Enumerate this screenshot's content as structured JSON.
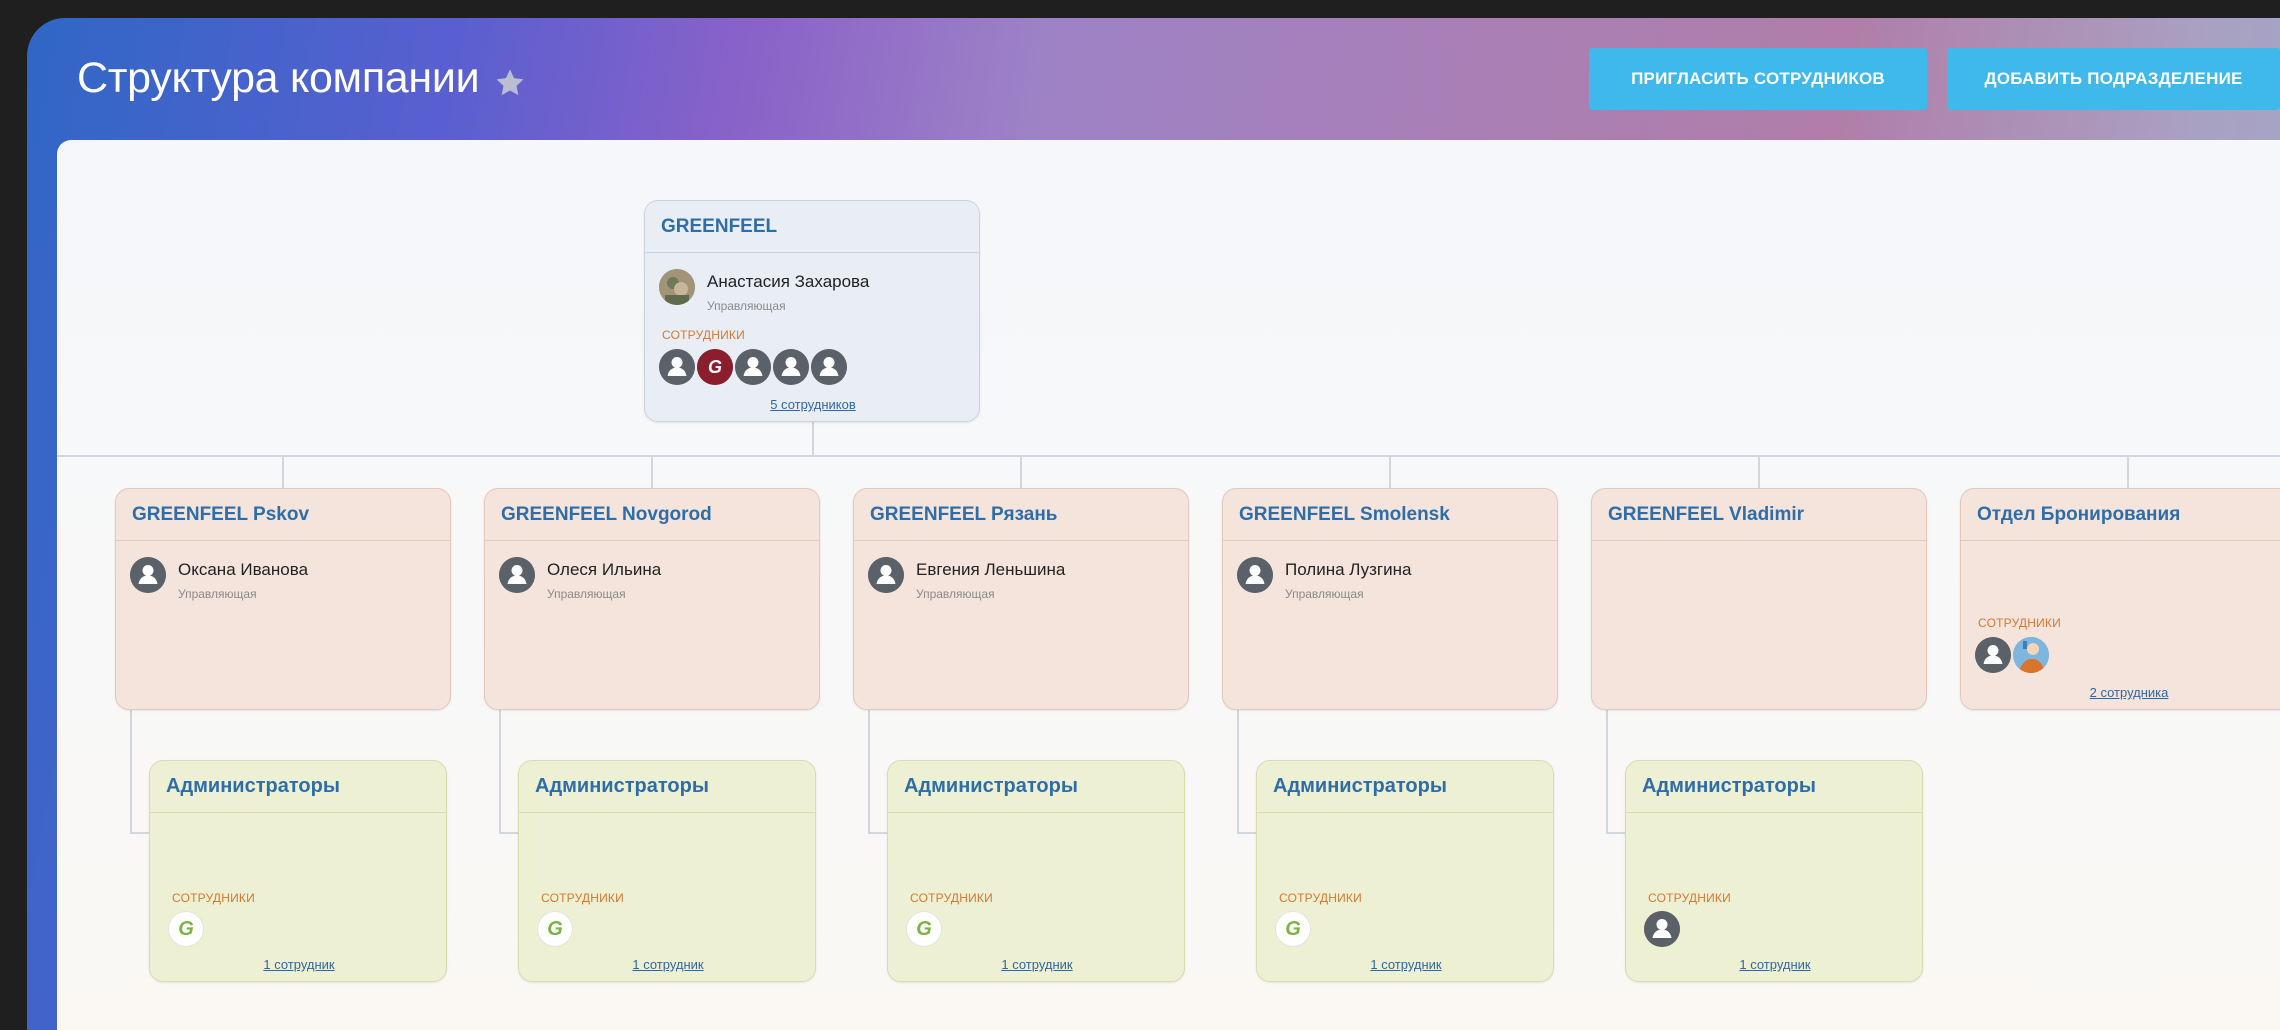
{
  "header": {
    "title": "Структура компании",
    "invite_button": "ПРИГЛАСИТЬ СОТРУДНИКОВ",
    "add_department_button": "ДОБАВИТЬ ПОДРАЗДЕЛЕНИЕ"
  },
  "root": {
    "name": "GREENFEEL",
    "head_name": "Анастасия Захарова",
    "head_role": "Управляющая",
    "employees_label": "СОТРУДНИКИ",
    "employee_count": "5 сотрудников"
  },
  "branches": [
    {
      "name": "GREENFEEL Pskov",
      "head_name": "Оксана Иванова",
      "head_role": "Управляющая"
    },
    {
      "name": "GREENFEEL Novgorod",
      "head_name": "Олеся Ильина",
      "head_role": "Управляющая"
    },
    {
      "name": "GREENFEEL Рязань",
      "head_name": "Евгения Леньшина",
      "head_role": "Управляющая"
    },
    {
      "name": "GREENFEEL Smolensk",
      "head_name": "Полина Лузгина",
      "head_role": "Управляющая"
    },
    {
      "name": "GREENFEEL Vladimir"
    },
    {
      "name": "Отдел Бронирования",
      "employees_label": "СОТРУДНИКИ",
      "employee_count": "2 сотрудника"
    }
  ],
  "subdepartments": [
    {
      "name": "Администраторы",
      "employees_label": "СОТРУДНИКИ",
      "employee_count": "1 сотрудник"
    },
    {
      "name": "Администраторы",
      "employees_label": "СОТРУДНИКИ",
      "employee_count": "1 сотрудник"
    },
    {
      "name": "Администраторы",
      "employees_label": "СОТРУДНИКИ",
      "employee_count": "1 сотрудник"
    },
    {
      "name": "Администраторы",
      "employees_label": "СОТРУДНИКИ",
      "employee_count": "1 сотрудник"
    },
    {
      "name": "Администраторы",
      "employees_label": "СОТРУДНИКИ",
      "employee_count": "1 сотрудник"
    }
  ],
  "logo_text": "G",
  "colors": {
    "accent_button": "#3fb8ec",
    "link": "#2d67a8",
    "employees_label": "#d8782d",
    "root_card": "#e9eef5",
    "branch_card": "#f4e4dc",
    "sub_card": "#eef0d4"
  }
}
